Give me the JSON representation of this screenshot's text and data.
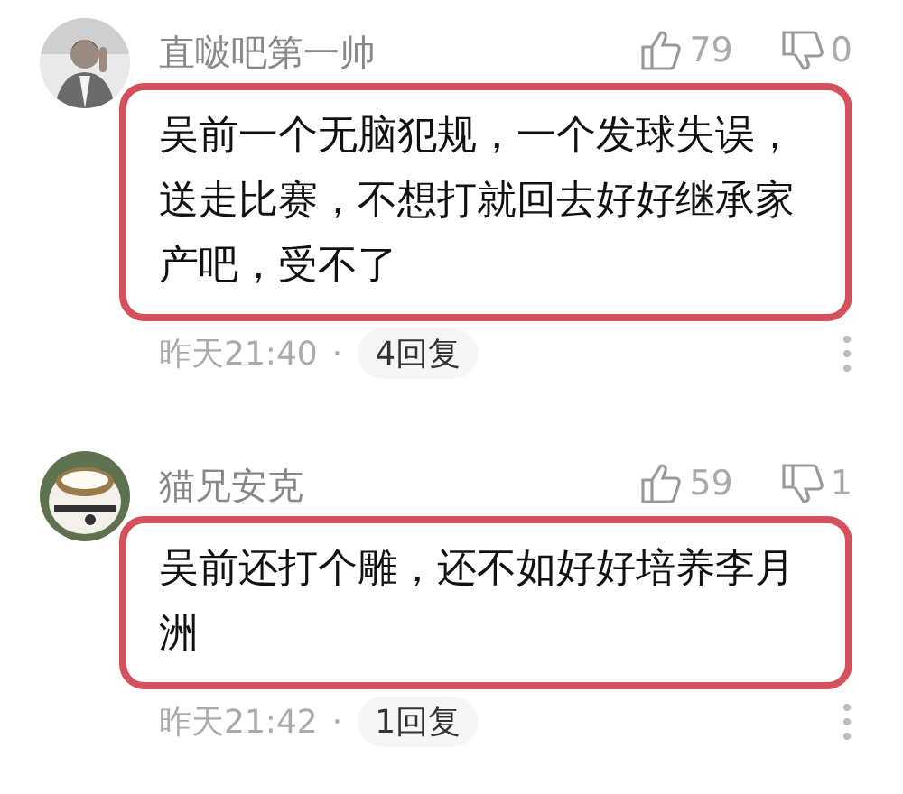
{
  "comments": [
    {
      "author": "直啵吧第一帅",
      "likes": "79",
      "dislikes": "0",
      "text": "吴前一个无脑犯规，一个发球失误，送走比赛，不想打就回去好好继承家产吧，受不了",
      "highlighted": true,
      "time": "昨天21:40",
      "separator": "·",
      "replies": "4回复"
    },
    {
      "author": "猫兄安克",
      "likes": "59",
      "dislikes": "1",
      "text": "吴前还打个雕，还不如好好培养李月洲",
      "highlighted": true,
      "time": "昨天21:42",
      "separator": "·",
      "replies": "1回复"
    }
  ]
}
